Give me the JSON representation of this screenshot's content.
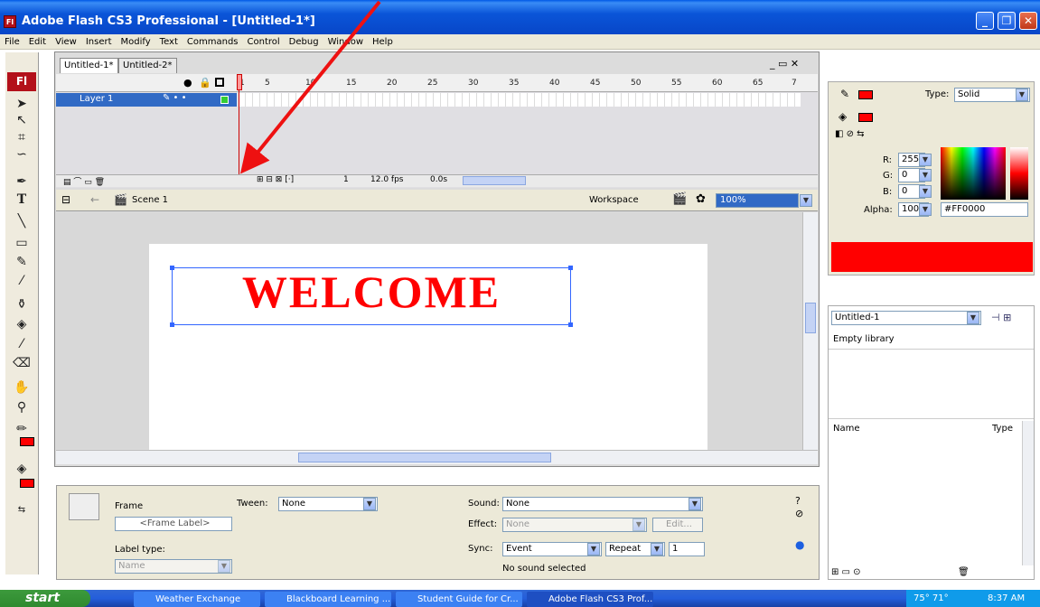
{
  "window": {
    "title": "Adobe Flash CS3 Professional - [Untitled-1*]",
    "logo": "Fl"
  },
  "menu": [
    "File",
    "Edit",
    "View",
    "Insert",
    "Modify",
    "Text",
    "Commands",
    "Control",
    "Debug",
    "Window",
    "Help"
  ],
  "doc_tabs": [
    "Untitled-1*",
    "Untitled-2*"
  ],
  "timeline": {
    "ruler": [
      "1",
      "5",
      "10",
      "15",
      "20",
      "25",
      "30",
      "35",
      "40",
      "45",
      "50",
      "55",
      "60",
      "65",
      "7"
    ],
    "layer_name": "Layer 1",
    "current_frame": "1",
    "fps": "12.0 fps",
    "time": "0.0s"
  },
  "editbar": {
    "scene": "Scene 1",
    "workspace": "Workspace",
    "zoom": "100%"
  },
  "stage": {
    "text": "WELCOME",
    "text_color": "#ff0000"
  },
  "color": {
    "type_label": "Type:",
    "type_value": "Solid",
    "r_label": "R:",
    "r": "255",
    "g_label": "G:",
    "g": "0",
    "b_label": "B:",
    "b": "0",
    "alpha_label": "Alpha:",
    "alpha": "100%",
    "hex": "#FF0000"
  },
  "library": {
    "doc": "Untitled-1",
    "empty": "Empty library",
    "col_name": "Name",
    "col_type": "Type"
  },
  "properties": {
    "frame_label": "Frame",
    "frame_placeholder": "<Frame Label>",
    "label_type": "Label type:",
    "label_type_value": "Name",
    "tween_label": "Tween:",
    "tween_value": "None",
    "sound_label": "Sound:",
    "sound_value": "None",
    "effect_label": "Effect:",
    "effect_value": "None",
    "edit_label": "Edit...",
    "sync_label": "Sync:",
    "sync_value": "Event",
    "repeat_value": "Repeat",
    "repeat_count": "1",
    "no_sound": "No sound selected"
  },
  "taskbar": {
    "start": "start",
    "tasks": [
      "Weather Exchange",
      "Blackboard Learning ...",
      "Student Guide for Cr...",
      "Adobe Flash CS3 Prof..."
    ],
    "temp": "75° 71°",
    "clock": "8:37 AM"
  },
  "icons": [
    "selection-tool-icon",
    "subselection-tool-icon",
    "free-transform-icon",
    "lasso-icon",
    "pen-icon",
    "text-tool-icon",
    "line-tool-icon",
    "rectangle-tool-icon",
    "pencil-icon",
    "brush-icon",
    "ink-bottle-icon",
    "paint-bucket-icon",
    "eyedropper-icon",
    "eraser-icon",
    "hand-icon",
    "zoom-icon"
  ]
}
